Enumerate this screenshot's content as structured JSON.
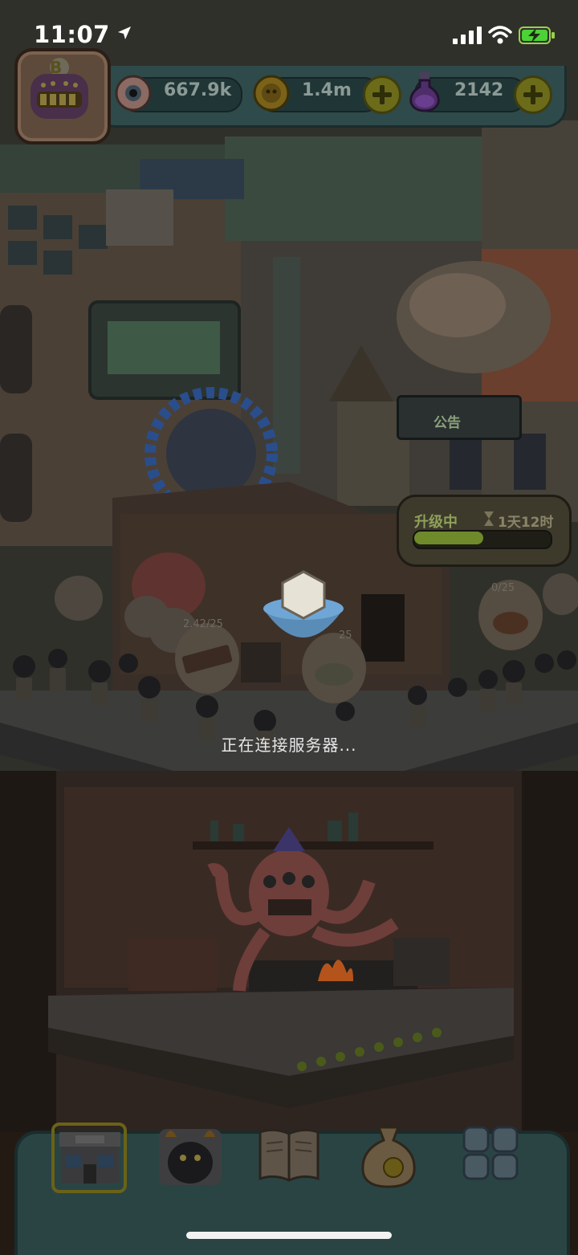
{
  "status_bar": {
    "time": "11:07",
    "location_icon": "location-arrow-icon",
    "signal_icon": "cellular-signal-icon",
    "wifi_icon": "wifi-icon",
    "battery_icon": "battery-charging-icon"
  },
  "resources": {
    "eyeballs": {
      "value": "667.9k",
      "icon": "eyeball-icon"
    },
    "coins": {
      "value": "1.4m",
      "icon": "coin-icon"
    },
    "potions": {
      "value": "2142",
      "icon": "potion-icon"
    },
    "avatar_letter": "B"
  },
  "notice_board": {
    "label": "公告"
  },
  "upgrade": {
    "label": "升级中",
    "timer": "1天12时",
    "timer_icon": "hourglass-icon",
    "progress": 0.52
  },
  "likes": {
    "stall_a": "2.42/25",
    "stall_b": "25",
    "stall_c": "0/25"
  },
  "loading_message": "正在连接服务器...",
  "bottom_nav": {
    "items": [
      {
        "name": "restaurant",
        "icon": "restaurant-building-icon",
        "selected": true
      },
      {
        "name": "monster",
        "icon": "monster-icon"
      },
      {
        "name": "recipe-book",
        "icon": "book-icon"
      },
      {
        "name": "shop",
        "icon": "money-bag-icon"
      },
      {
        "name": "more",
        "icon": "grid-menu-icon"
      }
    ]
  },
  "colors": {
    "overlay": "#000000",
    "accent_green": "#8fa05a",
    "panel_teal": "#2f4a4a"
  }
}
